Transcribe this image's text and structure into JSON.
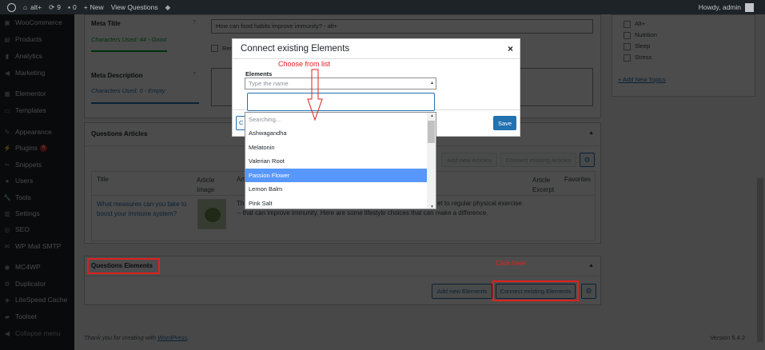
{
  "admin_bar": {
    "site_name": "alt+",
    "updates_count": "9",
    "comments_count": "0",
    "new_label": "New",
    "view_questions_label": "View Questions",
    "greeting": "Howdy, admin"
  },
  "sidebar": {
    "items": [
      {
        "label": "WooCommerce",
        "icon": "woocommerce-icon"
      },
      {
        "label": "Products",
        "icon": "products-icon"
      },
      {
        "label": "Analytics",
        "icon": "analytics-icon"
      },
      {
        "label": "Marketing",
        "icon": "marketing-icon"
      },
      {
        "label": "Elementor",
        "icon": "elementor-icon"
      },
      {
        "label": "Templates",
        "icon": "templates-icon"
      },
      {
        "label": "Appearance",
        "icon": "appearance-icon"
      },
      {
        "label": "Plugins",
        "icon": "plugins-icon",
        "badge": "6"
      },
      {
        "label": "Snippets",
        "icon": "snippets-icon"
      },
      {
        "label": "Users",
        "icon": "users-icon"
      },
      {
        "label": "Tools",
        "icon": "tools-icon"
      },
      {
        "label": "Settings",
        "icon": "settings-icon"
      },
      {
        "label": "SEO",
        "icon": "seo-icon"
      },
      {
        "label": "WP Mail SMTP",
        "icon": "mail-icon"
      },
      {
        "label": "MC4WP",
        "icon": "mc4wp-icon"
      },
      {
        "label": "Duplicator",
        "icon": "duplicator-icon"
      },
      {
        "label": "LiteSpeed Cache",
        "icon": "litespeed-icon"
      },
      {
        "label": "Toolset",
        "icon": "toolset-icon"
      },
      {
        "label": "Collapse menu",
        "icon": "collapse-icon"
      }
    ]
  },
  "seo_box": {
    "meta_title_label": "Meta Title",
    "meta_title_chars": "Characters Used: 44 - Good",
    "meta_title_value": "How can food habits improve immunity? - alt+",
    "meta_desc_label": "Meta Description",
    "meta_desc_chars": "Characters Used: 0 - Empty",
    "help_icon": "?",
    "partial_checkbox_label": "Rem"
  },
  "topics_box": {
    "items": [
      "Alt+",
      "Nutrition",
      "Sleep",
      "Stress"
    ],
    "add_new_link": "+ Add New Topics"
  },
  "questions_articles": {
    "title": "Questions Articles",
    "add_new_label": "Add new Articles",
    "connect_label": "Connect existing Articles",
    "columns": {
      "title": "Title",
      "article_image": "Article Image",
      "article_partial": "Art",
      "article_excerpt": "Article Excerpt",
      "favorites": "Favorites"
    },
    "row": {
      "title": "What measures can you take to boost your immune system?",
      "excerpt_partial_1": "Th",
      "excerpt_partial_2": "et to regular physical exercise",
      "excerpt_line_2": "-- that can improve immunity. Here are some lifestyle choices that can make a difference."
    }
  },
  "questions_elements": {
    "title": "Questions Elements",
    "add_new_label": "Add new Elements",
    "connect_label": "Connect existing Elements"
  },
  "footer": {
    "thanks_prefix": "Thank you for creating with ",
    "wordpress_link": "WordPress",
    "thanks_suffix": ".",
    "version": "Version 5.4.2"
  },
  "modal": {
    "title": "Connect existing Elements",
    "close": "×",
    "field_label": "Elements",
    "select_placeholder": "Type the name",
    "save_label": "Save",
    "cancel_partial": "C",
    "list": [
      "Searching...",
      "Ashwagandha",
      "Melatonin",
      "Valerian Root",
      "Passion Flower",
      "Lemon Balm",
      "Pink Salt"
    ],
    "selected_item": "Passion Flower"
  },
  "annotations": {
    "choose_from_list": "Choose from list",
    "click_here": "Click here"
  },
  "colors": {
    "admin_dark": "#1d2327",
    "primary_blue": "#2271b1",
    "annotation_red": "#e0201d",
    "highlight_blue": "#5897fb",
    "good_green": "#00a32a"
  }
}
